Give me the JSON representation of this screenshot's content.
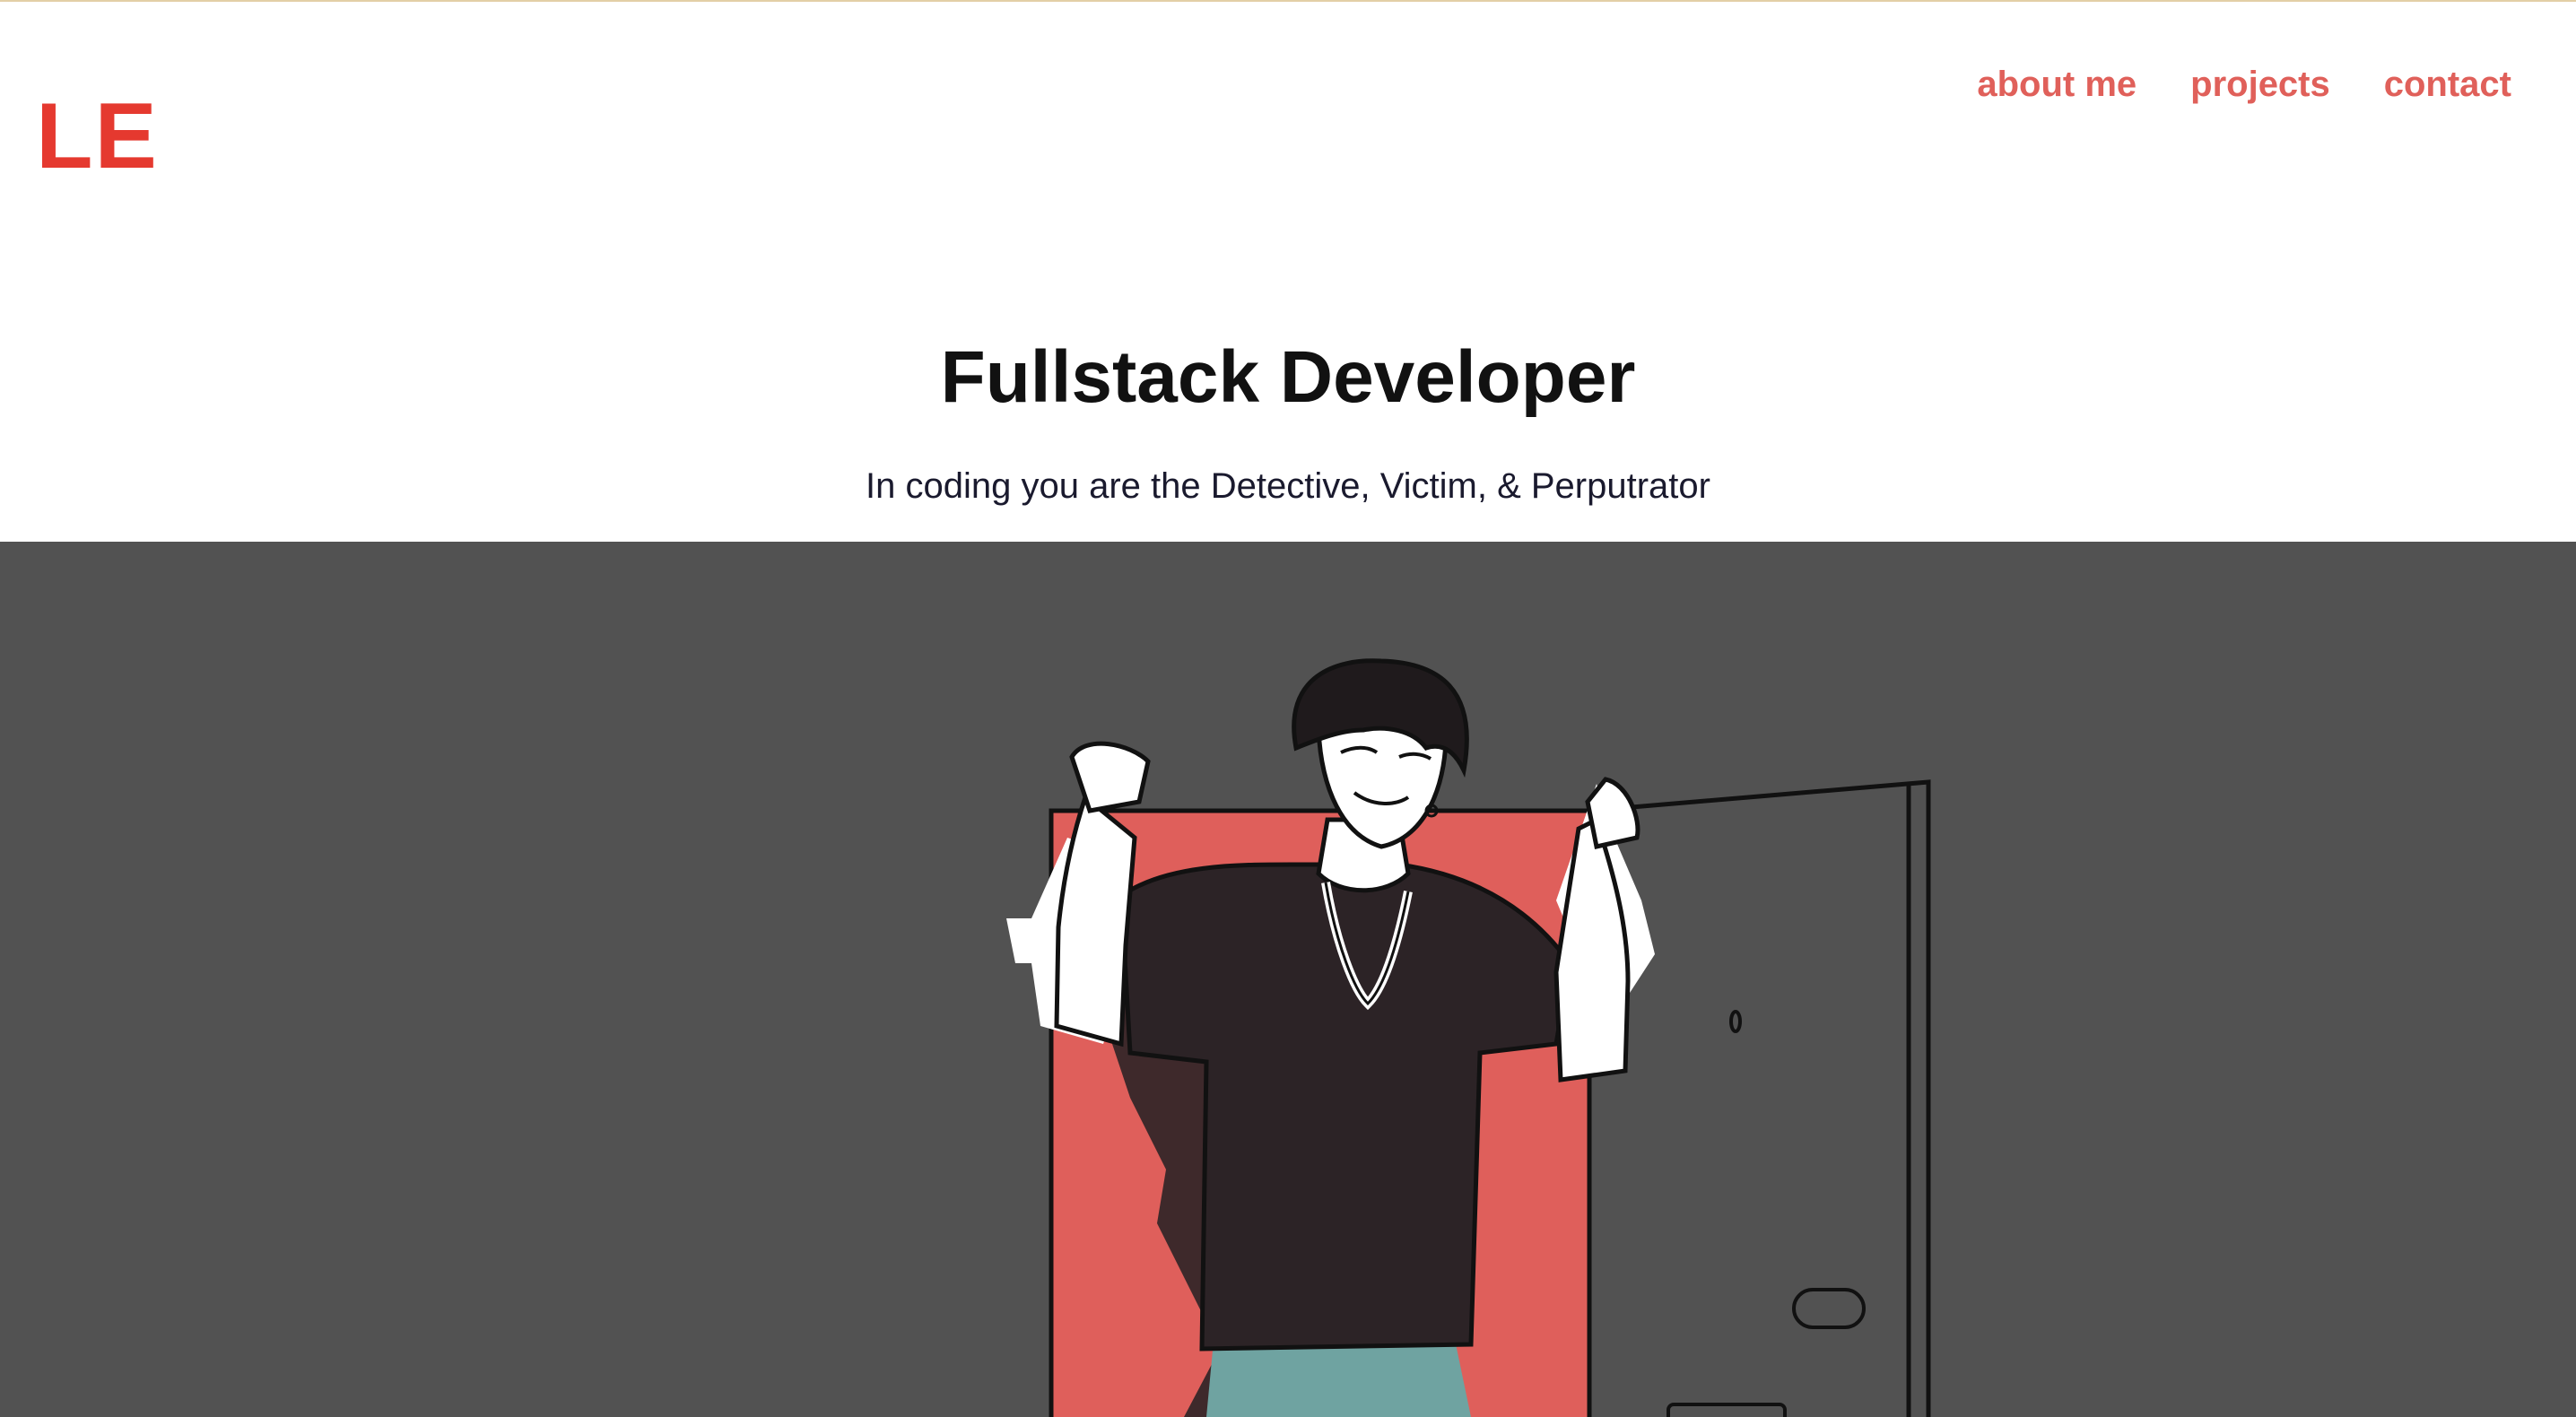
{
  "header": {
    "logo_text": "LE",
    "nav": [
      {
        "label": "about me"
      },
      {
        "label": "projects"
      },
      {
        "label": "contact"
      }
    ]
  },
  "hero": {
    "headline": "Fullstack Developer",
    "tagline": "In coding you are the Detective, Victim, & Perputrator",
    "illustration": "developer-illustration"
  },
  "colors": {
    "accent": "#e5392f",
    "nav_link": "#e0605a",
    "hero_background": "#525252",
    "door_red": "#df5f5b",
    "shirt": "#2c2326",
    "pants": "#6fa3a1"
  }
}
